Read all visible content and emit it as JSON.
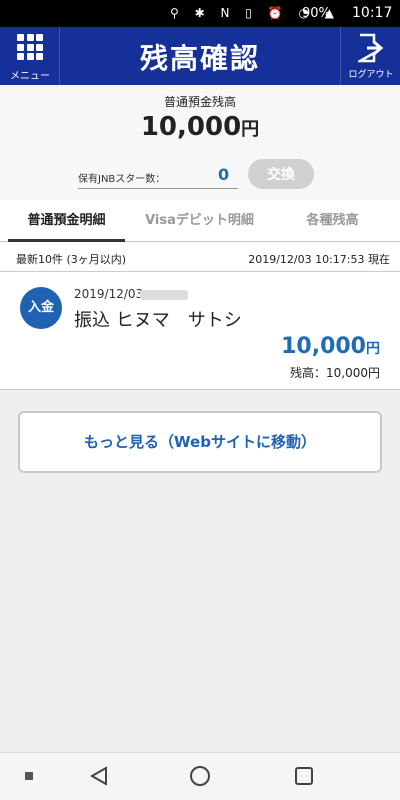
{
  "status_bar": {
    "battery": "90%",
    "time": "10:17"
  },
  "header": {
    "menu_label": "メニュー",
    "title": "残高確認",
    "logout_label": "ログアウト",
    "color": "#16309a"
  },
  "balance": {
    "label": "普通預金残高",
    "amount": "10,000",
    "currency": "円",
    "star_label": "保有JNBスター数：",
    "star_count": "0",
    "exchange_label": "交換"
  },
  "tabs": [
    {
      "label": "普通預金明細",
      "active": true
    },
    {
      "label": "Visaデビット明細",
      "active": false
    },
    {
      "label": "各種残高",
      "active": false
    }
  ],
  "summary": {
    "left": "最新10件 (3ヶ月以内)",
    "right": "2019/12/03 10:17:53 現在"
  },
  "transactions": [
    {
      "badge": "入金",
      "date": "2019/12/03",
      "description": "振込 ヒヌマ　サトシ",
      "amount": "10,000",
      "currency": "円",
      "remaining": "残高：10,000円"
    }
  ],
  "more_button": "もっと見る（Webサイトに移動）",
  "colors": {
    "accent_blue": "#1f6bb6",
    "badge_blue": "#1f62b3"
  }
}
